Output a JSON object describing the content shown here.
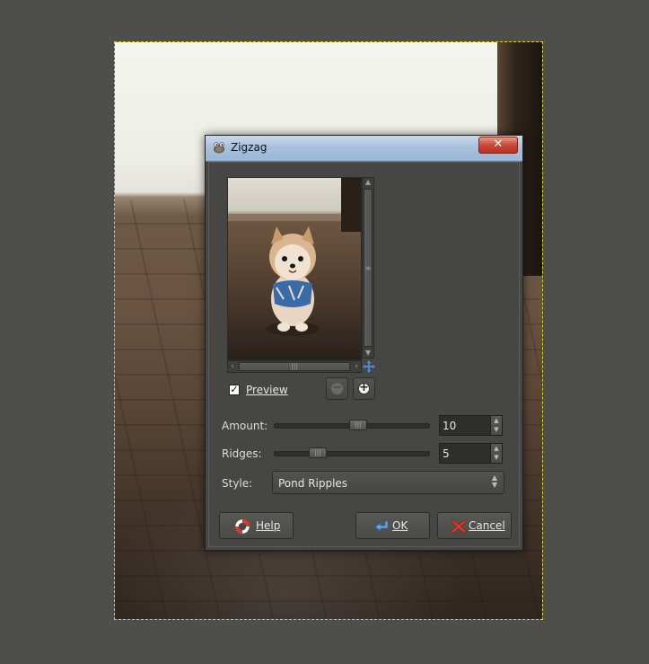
{
  "dialog": {
    "title": "Zigzag",
    "close_label": "✕"
  },
  "preview": {
    "checkbox_checked": true,
    "label": "Preview"
  },
  "params": {
    "amount": {
      "label": "Amount:",
      "value": "10",
      "position": 0.55
    },
    "ridges": {
      "label": "Ridges:",
      "value": "5",
      "position": 0.28
    },
    "style": {
      "label": "Style:",
      "value": "Pond Ripples"
    }
  },
  "buttons": {
    "help": "Help",
    "ok": "OK",
    "cancel": "Cancel"
  },
  "colors": {
    "selection_border": "#e0d400",
    "workspace": "#4e4f4b",
    "dialog_bg": "#464744"
  }
}
